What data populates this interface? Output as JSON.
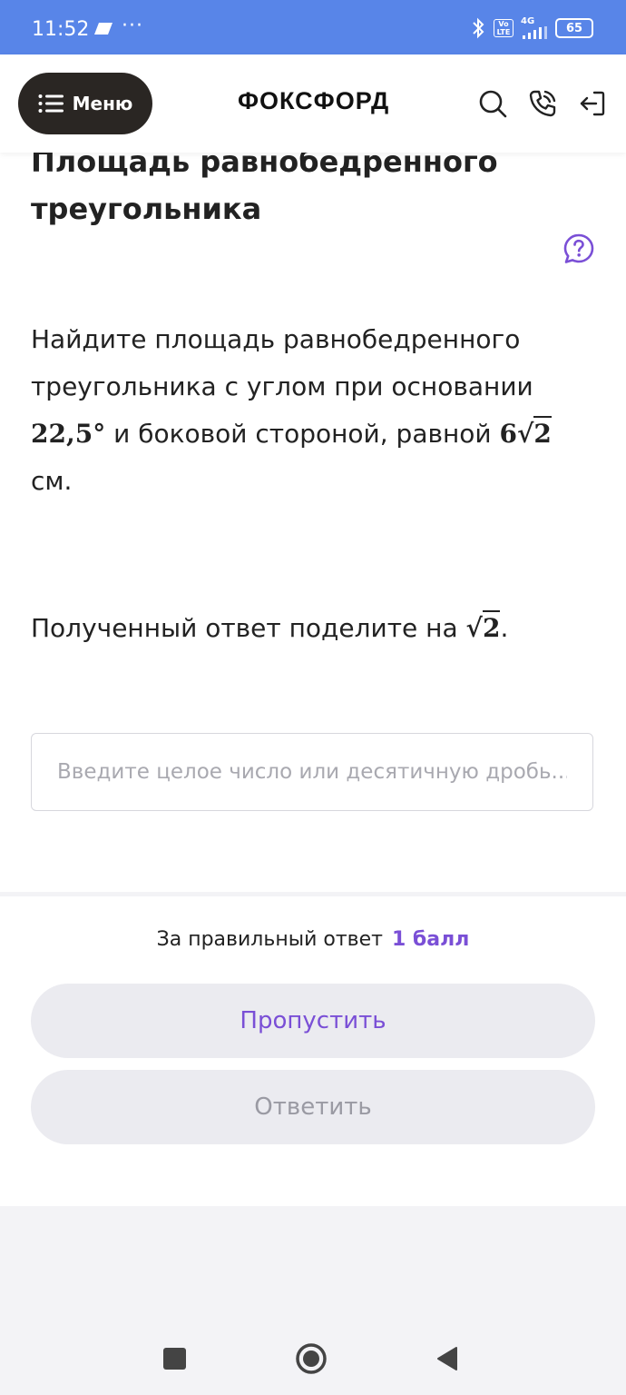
{
  "status_bar": {
    "time": "11:52",
    "dots": "···",
    "network": "4G",
    "volte": "Vo LTE",
    "battery": "65"
  },
  "header": {
    "menu_label": "Меню",
    "logo_text": "ФОКСФОРД"
  },
  "task": {
    "title": "Площадь равнобедренного треугольника",
    "text_part1": "Найдите площадь равнобедренного треугольника с углом при основании",
    "angle": "22,5°",
    "text_part2": "и боковой стороной, равной",
    "side_coef": "6",
    "side_root": "2",
    "unit": "см.",
    "instruction": "Полученный ответ поделите на",
    "divisor_root": "2",
    "instruction_end": "."
  },
  "answer": {
    "placeholder": "Введите целое число или десятичную дробь..."
  },
  "footer": {
    "score_label": "За правильный ответ",
    "score_value": "1 балл",
    "skip_label": "Пропустить",
    "answer_label": "Ответить"
  },
  "colors": {
    "status_bar": "#5885e8",
    "accent": "#7a4fd6",
    "menu_button": "#2a2623",
    "button_bg": "#ebebf0"
  }
}
